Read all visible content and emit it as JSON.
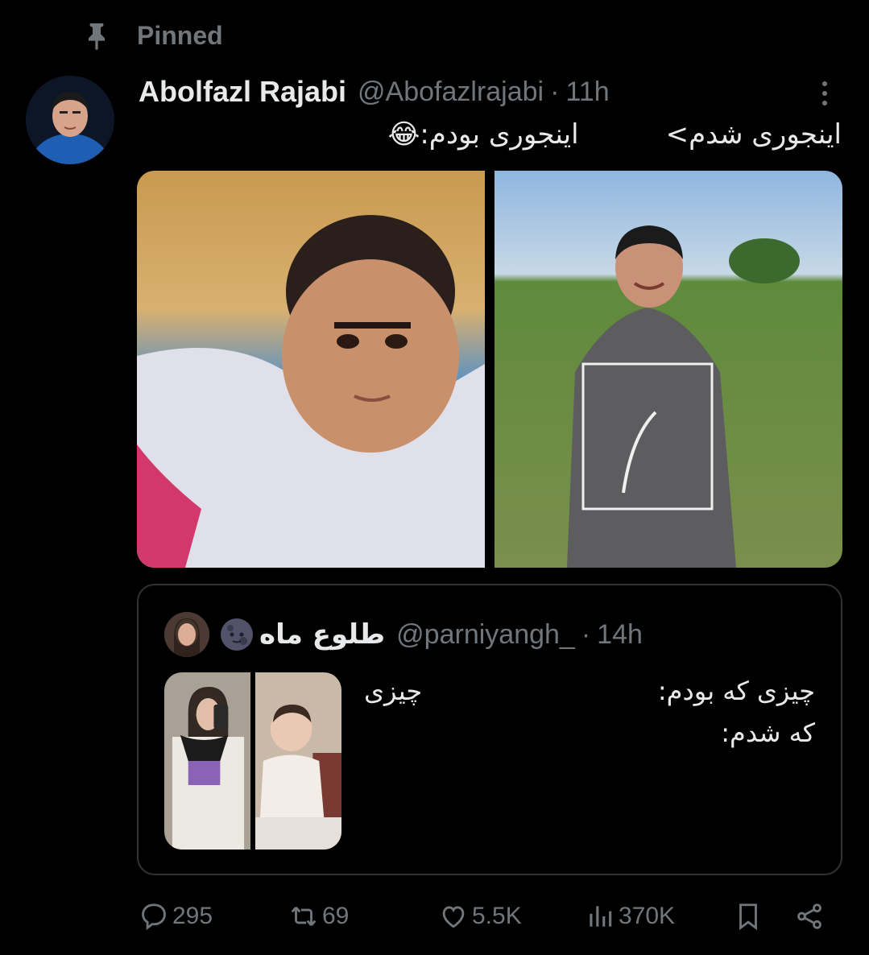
{
  "pinned": {
    "label": "Pinned",
    "icon": "pin-icon"
  },
  "tweet": {
    "author_name": "Abolfazl Rajabi",
    "author_handle": "@Abofazlrajabi",
    "separator": "·",
    "time": "11h",
    "text": "اینجوری شدم>          اینجوری بودم:😂",
    "media": [
      {
        "alt": "photo-child",
        "icon": "photo"
      },
      {
        "alt": "photo-adult",
        "icon": "photo"
      }
    ]
  },
  "quote": {
    "name": "طلوع ماه",
    "emoji": "🌚",
    "handle": "@parniyangh_",
    "separator": "·",
    "time": "14h",
    "text_line1_a": "چیزی که بودم:",
    "text_line1_b": "چیزی",
    "text_line2": "که شدم:"
  },
  "actions": {
    "replies": "295",
    "reposts": "69",
    "likes": "5.5K",
    "views": "370K"
  },
  "colors": {
    "background": "#000000",
    "text": "#e7e9ea",
    "muted": "#71767b",
    "border": "#2f3336"
  }
}
